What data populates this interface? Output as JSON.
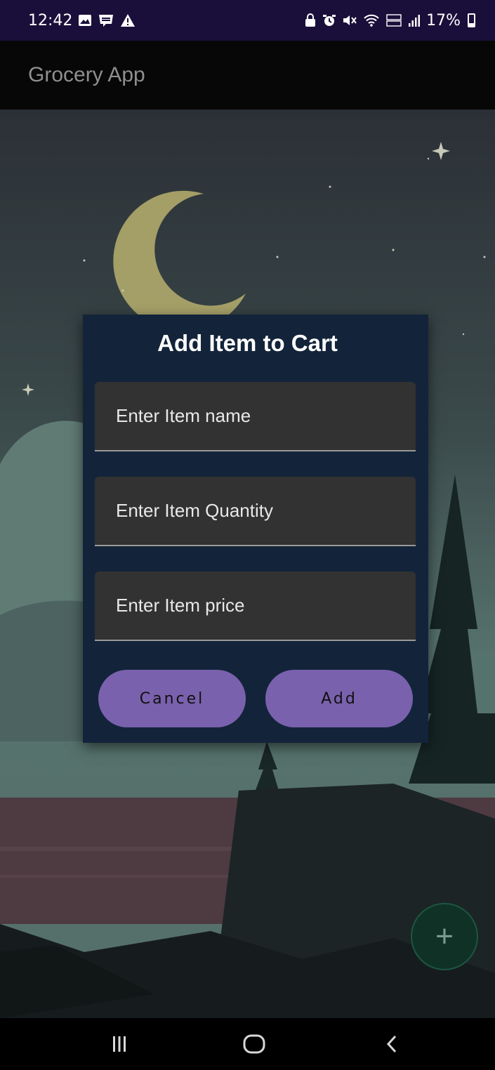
{
  "status_bar": {
    "time": "12:42",
    "battery_text": "17%",
    "left_icons": [
      "gallery-icon",
      "webtoon-icon",
      "warning-icon"
    ],
    "right_icons": [
      "lock-icon",
      "alarm-icon",
      "mute-icon",
      "wifi-icon",
      "volte-icon",
      "signal-icon",
      "battery-icon"
    ]
  },
  "app_bar": {
    "title": "Grocery App"
  },
  "dialog": {
    "title": "Add Item to Cart",
    "fields": [
      {
        "name": "item-name",
        "placeholder": "Enter Item name",
        "value": ""
      },
      {
        "name": "item-quantity",
        "placeholder": "Enter Item Quantity",
        "value": ""
      },
      {
        "name": "item-price",
        "placeholder": "Enter Item price",
        "value": ""
      }
    ],
    "cancel_label": "Cancel",
    "add_label": "Add"
  },
  "fab": {
    "icon": "plus-icon",
    "label": "+"
  },
  "colors": {
    "status_bar": "#1a0f3a",
    "dialog_bg": "#13243a",
    "field_bg": "#323232",
    "button": "#7a61ad",
    "fab": "#103226"
  },
  "nav_bar": {
    "icons": [
      "recents-icon",
      "home-icon",
      "back-icon"
    ]
  }
}
